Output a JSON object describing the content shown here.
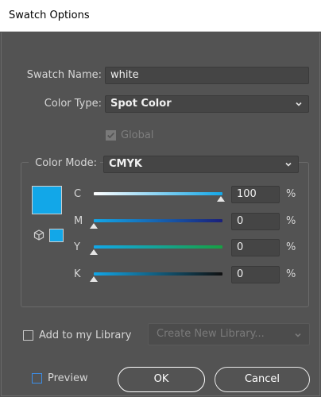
{
  "window": {
    "title": "Swatch Options"
  },
  "swatch_name": {
    "label": "Swatch Name:",
    "value": "white"
  },
  "color_type": {
    "label": "Color Type:",
    "value": "Spot Color"
  },
  "global": {
    "label": "Global",
    "checked": true,
    "disabled": true
  },
  "color_mode": {
    "label": "Color Mode:",
    "value": "CMYK"
  },
  "swatch_color": "#12a7e8",
  "channels": [
    {
      "label": "C",
      "value": "100",
      "unit": "%",
      "fraction": 1.0,
      "gradient": [
        "#ffffff",
        "#12a7e8"
      ]
    },
    {
      "label": "M",
      "value": "0",
      "unit": "%",
      "fraction": 0.0,
      "gradient": [
        "#12a7e8",
        "#1a1f7a"
      ]
    },
    {
      "label": "Y",
      "value": "0",
      "unit": "%",
      "fraction": 0.0,
      "gradient": [
        "#12a7e8",
        "#17a043"
      ]
    },
    {
      "label": "K",
      "value": "0",
      "unit": "%",
      "fraction": 0.0,
      "gradient": [
        "#12a7e8",
        "#101010"
      ]
    }
  ],
  "library": {
    "label": "Add to my Library",
    "checked": false,
    "select_value": "Create New Library..."
  },
  "preview": {
    "label": "Preview",
    "checked": false
  },
  "buttons": {
    "ok": "OK",
    "cancel": "Cancel"
  }
}
